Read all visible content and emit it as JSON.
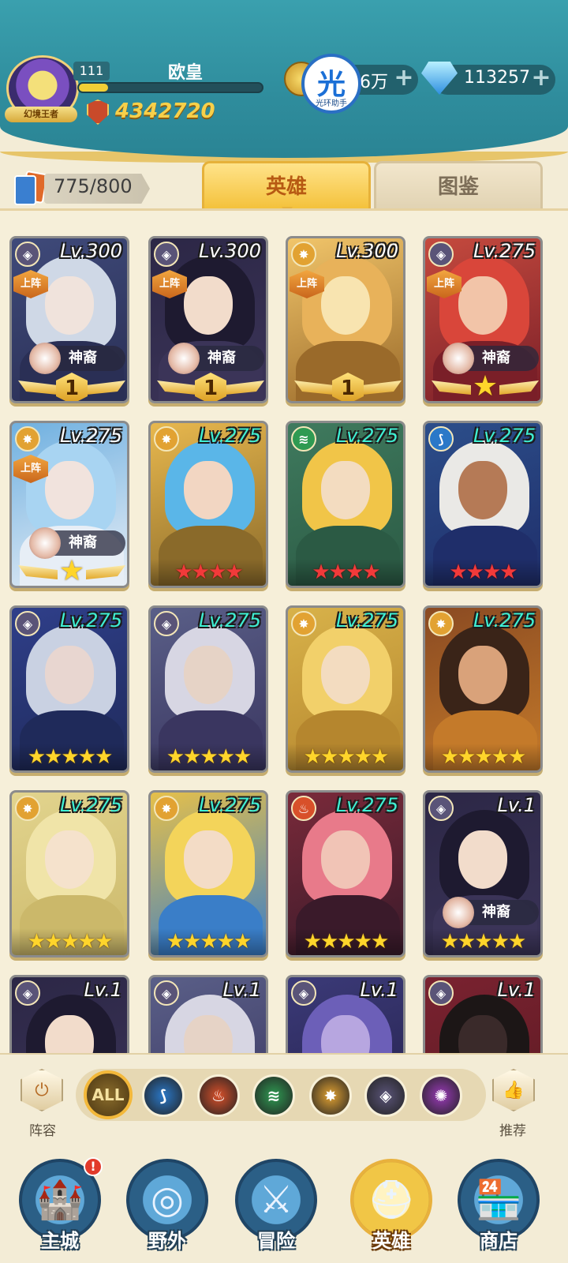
{
  "player": {
    "level": "111",
    "name": "欧皇",
    "avatar_ribbon": "幻境王者",
    "xp_fraction": 0.16,
    "power": "4342720"
  },
  "currency": {
    "gold": "6万",
    "gems": "113257",
    "assistant_char": "光",
    "assistant_label": "光环助手"
  },
  "roster": {
    "count": "775/800"
  },
  "tabs": [
    {
      "label": "英雄",
      "active": true
    },
    {
      "label": "图鉴",
      "active": false
    }
  ],
  "heroes": [
    {
      "level": "Lv.300",
      "level_color": "white",
      "faction": "void",
      "deployed": "上阵",
      "divine": "神裔",
      "rank_type": "wing-num",
      "rank": "1",
      "palette": [
        "#3f4a7a",
        "#f0e3dc",
        "#cfd8e6",
        "#2a2f55"
      ]
    },
    {
      "level": "Lv.300",
      "level_color": "white",
      "faction": "void",
      "deployed": "上阵",
      "divine": "神裔",
      "rank_type": "wing-num",
      "rank": "1",
      "palette": [
        "#2c2746",
        "#f2dccb",
        "#1e1a30",
        "#3b3458"
      ]
    },
    {
      "level": "Lv.300",
      "level_color": "white",
      "faction": "light",
      "deployed": "上阵",
      "divine": "",
      "rank_type": "wing-num",
      "rank": "1",
      "palette": [
        "#f1c56a",
        "#f8e4b0",
        "#e8b25a",
        "#9a6a2a"
      ]
    },
    {
      "level": "Lv.275",
      "level_color": "white",
      "faction": "void",
      "deployed": "上阵",
      "divine": "神裔",
      "rank_type": "wing-star",
      "rank": "★",
      "palette": [
        "#c54a3e",
        "#f2c4a8",
        "#d9463a",
        "#7a1f28"
      ]
    },
    {
      "level": "Lv.275",
      "level_color": "white",
      "faction": "light",
      "deployed": "上阵",
      "divine": "神裔",
      "rank_type": "wing-star",
      "rank": "★",
      "palette": [
        "#6fb0e0",
        "#f1e3dd",
        "#a8d4f2",
        "#e7eef6"
      ]
    },
    {
      "level": "Lv.275",
      "level_color": "cyan",
      "faction": "light",
      "deployed": "",
      "divine": "",
      "rank_type": "stars-red",
      "rank": "★★★★",
      "palette": [
        "#e8b84e",
        "#f2d6c2",
        "#5ab6e8",
        "#8a6a2a"
      ]
    },
    {
      "level": "Lv.275",
      "level_color": "cyan",
      "faction": "nature",
      "deployed": "",
      "divine": "",
      "rank_type": "stars-red",
      "rank": "★★★★",
      "palette": [
        "#3f7a5e",
        "#f3dcc0",
        "#f1c548",
        "#2b5a44"
      ]
    },
    {
      "level": "Lv.275",
      "level_color": "cyan",
      "faction": "water",
      "deployed": "",
      "divine": "",
      "rank_type": "stars-red",
      "rank": "★★★★",
      "palette": [
        "#2c4e8a",
        "#b57a56",
        "#eae9e6",
        "#1f2e6a"
      ]
    },
    {
      "level": "Lv.275",
      "level_color": "cyan",
      "faction": "void",
      "deployed": "",
      "divine": "",
      "rank_type": "stars-gold",
      "rank": "★★★★★",
      "palette": [
        "#2f3f8a",
        "#e8d6d0",
        "#c9d1e2",
        "#1f2a5a"
      ]
    },
    {
      "level": "Lv.275",
      "level_color": "cyan",
      "faction": "void",
      "deployed": "",
      "divine": "",
      "rank_type": "stars-gold",
      "rank": "★★★★★",
      "palette": [
        "#5a5f88",
        "#e6d3c6",
        "#d7d6e3",
        "#3a3660"
      ]
    },
    {
      "level": "Lv.275",
      "level_color": "cyan",
      "faction": "light",
      "deployed": "",
      "divine": "",
      "rank_type": "stars-gold",
      "rank": "★★★★★",
      "palette": [
        "#d8b24a",
        "#f3dcc0",
        "#f2d06a",
        "#b5862e"
      ]
    },
    {
      "level": "Lv.275",
      "level_color": "cyan",
      "faction": "light",
      "deployed": "",
      "divine": "",
      "rank_type": "stars-gold",
      "rank": "★★★★★",
      "palette": [
        "#8a4a22",
        "#d9a27a",
        "#3a2418",
        "#c47a2a"
      ]
    },
    {
      "level": "Lv.275",
      "level_color": "cyan",
      "faction": "light",
      "deployed": "",
      "divine": "",
      "rank_type": "stars-gold",
      "rank": "★★★★★",
      "palette": [
        "#e2d48e",
        "#f5e2cc",
        "#f0e4a8",
        "#cbb86a"
      ]
    },
    {
      "level": "Lv.275",
      "level_color": "cyan",
      "faction": "light",
      "deployed": "",
      "divine": "",
      "rank_type": "stars-gold",
      "rank": "★★★★★",
      "palette": [
        "#e6c04a",
        "#f3dcc6",
        "#f3d45a",
        "#3a7ec8"
      ]
    },
    {
      "level": "Lv.275",
      "level_color": "cyan",
      "faction": "fire",
      "deployed": "",
      "divine": "",
      "rank_type": "stars-gold",
      "rank": "★★★★★",
      "palette": [
        "#7a2a3a",
        "#f1c4b6",
        "#e87a8a",
        "#3a1a2a"
      ]
    },
    {
      "level": "Lv.1",
      "level_color": "white",
      "faction": "void",
      "deployed": "",
      "divine": "神裔",
      "rank_type": "stars-gold",
      "rank": "★★★★★",
      "palette": [
        "#2c2746",
        "#f2dccb",
        "#1e1a30",
        "#3b3458"
      ]
    },
    {
      "level": "Lv.1",
      "level_color": "white",
      "faction": "void",
      "deployed": "",
      "divine": "",
      "rank_type": "none",
      "rank": "",
      "palette": [
        "#2c2746",
        "#f2dccb",
        "#1e1a30",
        "#3b3458"
      ]
    },
    {
      "level": "Lv.1",
      "level_color": "white",
      "faction": "void",
      "deployed": "",
      "divine": "",
      "rank_type": "none",
      "rank": "",
      "palette": [
        "#5a5f88",
        "#e6d3c6",
        "#d7d6e3",
        "#3a3660"
      ]
    },
    {
      "level": "Lv.1",
      "level_color": "white",
      "faction": "void",
      "deployed": "",
      "divine": "",
      "rank_type": "none",
      "rank": "",
      "palette": [
        "#3b3a78",
        "#b7a6e0",
        "#6c5fb8",
        "#24204a"
      ]
    },
    {
      "level": "Lv.1",
      "level_color": "white",
      "faction": "void",
      "deployed": "",
      "divine": "",
      "rank_type": "none",
      "rank": "",
      "palette": [
        "#7a2230",
        "#3a2a2a",
        "#1c1616",
        "#5a1a22"
      ]
    }
  ],
  "faction_colors": {
    "void": "#5a5478",
    "light": "#e2a232",
    "nature": "#2f9a52",
    "water": "#2a78c8",
    "fire": "#d8502a"
  },
  "filters": {
    "lineup_label": "阵容",
    "recommend_label": "推荐",
    "items": [
      {
        "name": "all",
        "label": "ALL",
        "color": "#4a3512"
      },
      {
        "name": "water",
        "label": "",
        "color": "#2a78c8"
      },
      {
        "name": "fire",
        "label": "",
        "color": "#d8502a"
      },
      {
        "name": "nature",
        "label": "",
        "color": "#2f9a52"
      },
      {
        "name": "light",
        "label": "",
        "color": "#e2a232"
      },
      {
        "name": "void",
        "label": "",
        "color": "#5a5478"
      },
      {
        "name": "arcane",
        "label": "",
        "color": "#9a3ab8"
      }
    ]
  },
  "nav": [
    {
      "label": "主城",
      "icon": "castle-icon",
      "glyph": "🏰",
      "active": false,
      "alert": "!"
    },
    {
      "label": "野外",
      "icon": "portal-icon",
      "glyph": "◎",
      "active": false,
      "alert": ""
    },
    {
      "label": "冒险",
      "icon": "sword-icon",
      "glyph": "⚔",
      "active": false,
      "alert": ""
    },
    {
      "label": "英雄",
      "icon": "helmet-icon",
      "glyph": "⛑",
      "active": true,
      "alert": ""
    },
    {
      "label": "商店",
      "icon": "shop-icon",
      "glyph": "🏪",
      "active": false,
      "alert": ""
    }
  ]
}
